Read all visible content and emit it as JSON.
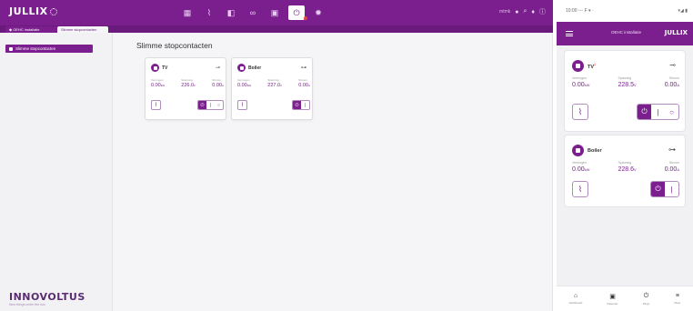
{
  "app": {
    "logo": "JULLIX",
    "nav_icons": [
      {
        "name": "grid-icon",
        "glyph": "▦"
      },
      {
        "name": "chart-icon",
        "glyph": "⌇"
      },
      {
        "name": "meter-icon",
        "glyph": "◧"
      },
      {
        "name": "infinity-icon",
        "glyph": "∞"
      },
      {
        "name": "calendar-icon",
        "glyph": "▣"
      },
      {
        "name": "plug-icon",
        "glyph": "⏻",
        "active": true
      },
      {
        "name": "gear-icon",
        "glyph": "✹"
      }
    ],
    "topright": {
      "user": "mtmk",
      "icons": [
        "user-icon",
        "search-icon",
        "bell-icon",
        "help-icon"
      ]
    },
    "breadcrumbs": [
      "◆ OEHC installatie",
      "Slimme stopcontacten"
    ],
    "sidebar_item": "Slimme stopcontacten",
    "brand": "INNOVOLTUS",
    "tagline": "New things under the sun",
    "page_title": "Slimme stopcontacten",
    "accent": "#7b1f8f"
  },
  "desktop_cards": [
    {
      "name": "TV",
      "metrics": [
        {
          "label": "Vermogen",
          "value": "0.00",
          "unit": "kW"
        },
        {
          "label": "Spanning",
          "value": "226.0",
          "unit": "V"
        },
        {
          "label": "Stroom",
          "value": "0.00",
          "unit": "A"
        }
      ],
      "seg": [
        "⏻",
        "|",
        "○"
      ]
    },
    {
      "name": "Boiler",
      "metrics": [
        {
          "label": "Vermogen",
          "value": "0.00",
          "unit": "kW"
        },
        {
          "label": "Spanning",
          "value": "227.0",
          "unit": "V"
        },
        {
          "label": "Stroom",
          "value": "0.00",
          "unit": "A"
        }
      ],
      "seg": [
        "⏻",
        "|"
      ]
    }
  ],
  "phone": {
    "status_left": "10:00 ◦◦◦ F ▾ ·",
    "status_right": "▾◢ ▮",
    "header_title": "OEHC installatie",
    "logo": "JULLIX",
    "cards": [
      {
        "name": "TV",
        "badge": "1",
        "metrics": [
          {
            "label": "Vermogen",
            "value": "0.00",
            "unit": "kW"
          },
          {
            "label": "Spanning",
            "value": "228.5",
            "unit": "V"
          },
          {
            "label": "Stroom",
            "value": "0.00",
            "unit": "A"
          }
        ],
        "seg": [
          "⏻",
          "|",
          "○"
        ]
      },
      {
        "name": "Boiler",
        "metrics": [
          {
            "label": "Vermogen",
            "value": "0.00",
            "unit": "kW"
          },
          {
            "label": "Spanning",
            "value": "228.6",
            "unit": "V"
          },
          {
            "label": "Stroom",
            "value": "0.00",
            "unit": "A"
          }
        ],
        "seg": [
          "⏻",
          "|"
        ]
      }
    ],
    "bottom_nav": [
      {
        "label": "Dashboard",
        "glyph": "⌂"
      },
      {
        "label": "Kalender",
        "glyph": "▣"
      },
      {
        "label": "Plugs",
        "glyph": "⏻"
      },
      {
        "label": "Meer",
        "glyph": "≡"
      }
    ]
  }
}
